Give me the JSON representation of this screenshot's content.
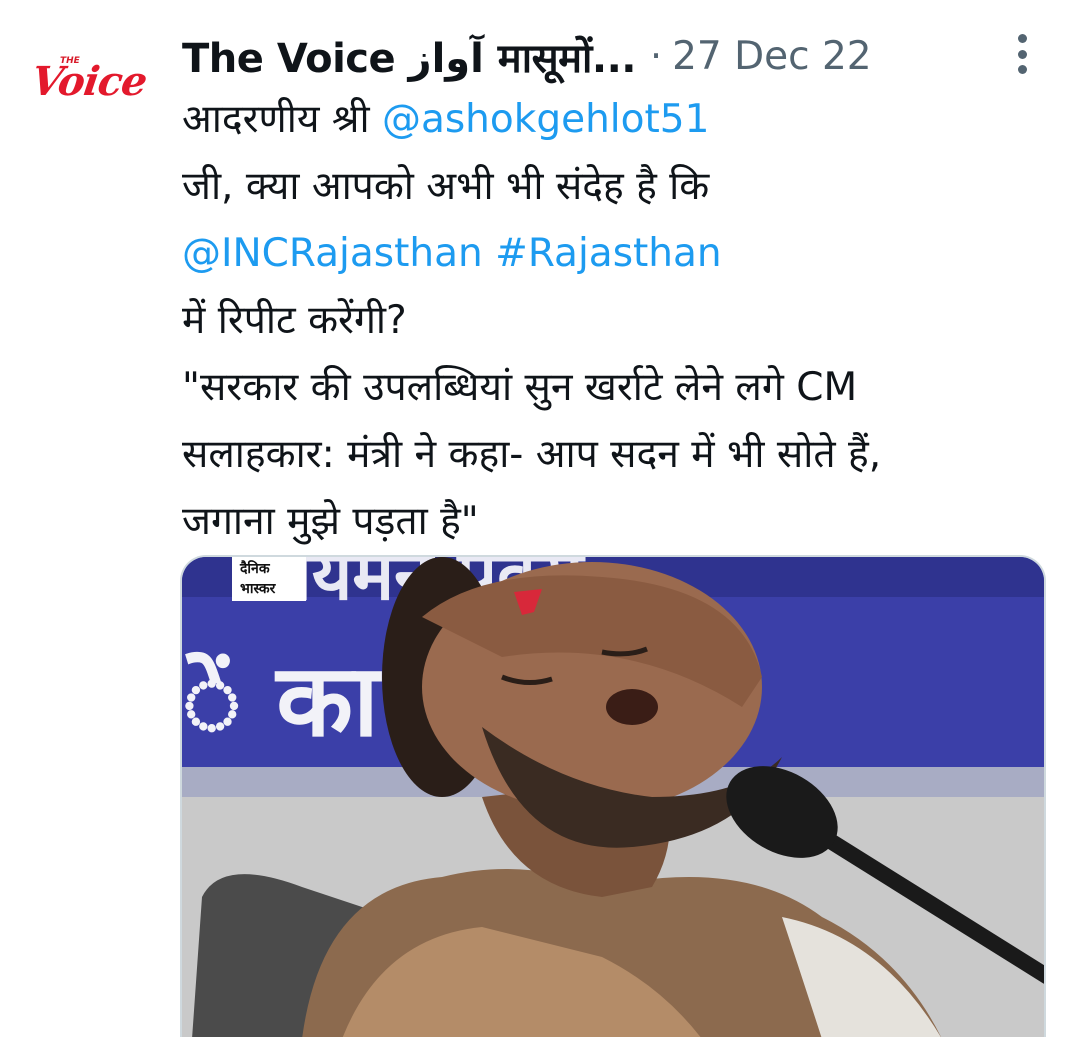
{
  "tweet": {
    "avatar": {
      "label_small": "THE",
      "label_main": "Voice",
      "icon": "the-voice-logo"
    },
    "author": {
      "display_name": "The Voice آواز मासूमों...",
      "separator": "·",
      "timestamp": "27 Dec 22"
    },
    "more_icon": "more-vertical-icon",
    "text": {
      "line1_prefix": "आदरणीय श्री ",
      "line1_mention": "@ashokgehlot51",
      "line2": "जी, क्या आपको अभी भी संदेह है कि",
      "line3_mention": "@INCRajasthan",
      "line3_space": " ",
      "line3_hashtag": "#Rajasthan",
      "line4": "में रिपीट करेंगी?",
      "line5": "\"सरकार की उपलब्धियां सुन खर्राटे लेने लगे CM",
      "line6": "सलाहकार: मंत्री ने कहा- आप सदन में भी सोते हैं,",
      "line7": "जगाना मुझे पड़ता है\""
    },
    "media": {
      "source_logo_line1": "दैनिक",
      "source_logo_line2": "भास्कर",
      "banner_text_top": "ायमन पूवस",
      "banner_text_bottom": "ें का य, सि"
    },
    "colors": {
      "link": "#1d9bf0",
      "muted": "#536471",
      "text": "#0f1419",
      "brand_red": "#e3192c",
      "banner_blue": "#3a3fa6"
    }
  }
}
